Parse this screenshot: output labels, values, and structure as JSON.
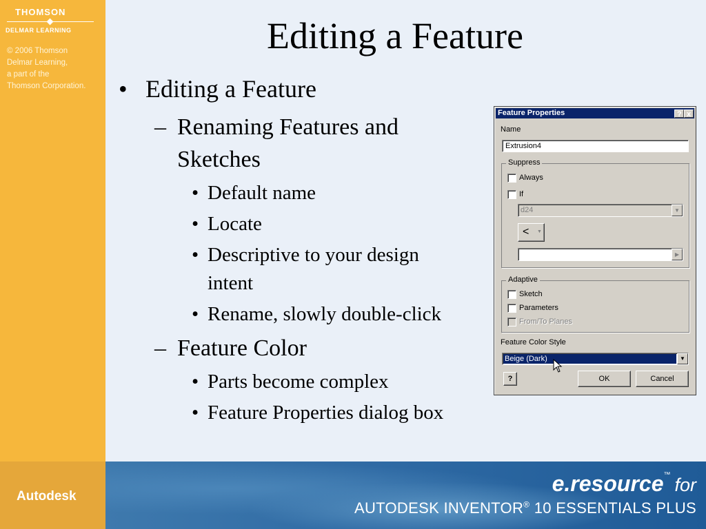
{
  "sidebar": {
    "brand_top": "THOMSON",
    "brand_bottom": "DELMAR LEARNING",
    "copyright": [
      "© 2006 Thomson",
      "Delmar Learning,",
      "a part of the",
      "Thomson Corporation."
    ]
  },
  "footer": {
    "left_label": "Autodesk",
    "eresource": "e.resource",
    "tm": "™",
    "for": "for",
    "product": "AUTODESK INVENTOR",
    "reg": "®",
    "product_rest": " 10 ESSENTIALS PLUS"
  },
  "slide": {
    "title": "Editing a Feature",
    "bullets": [
      {
        "level": 1,
        "marker": "•",
        "text": "Editing a Feature"
      },
      {
        "level": 2,
        "marker": "–",
        "text": "Renaming Features and"
      },
      {
        "level": 2,
        "marker": "",
        "text": "Sketches"
      },
      {
        "level": 3,
        "marker": "•",
        "text": "Default name"
      },
      {
        "level": 3,
        "marker": "•",
        "text": "Locate"
      },
      {
        "level": 3,
        "marker": "•",
        "text": "Descriptive to your design"
      },
      {
        "level": 3,
        "marker": "",
        "text": "intent"
      },
      {
        "level": 3,
        "marker": "•",
        "text": "Rename, slowly double-click"
      },
      {
        "level": 2,
        "marker": "–",
        "text": "Feature Color"
      },
      {
        "level": 3,
        "marker": "•",
        "text": "Parts become complex"
      },
      {
        "level": 3,
        "marker": "•",
        "text": "Feature Properties dialog box"
      }
    ]
  },
  "dialog": {
    "title": "Feature Properties",
    "help_btn": "?",
    "close_btn": "x",
    "name_label": "Name",
    "name_value": "Extrusion4",
    "suppress_label": "Suppress",
    "always_label": "Always",
    "if_label": "If",
    "param_value": "d24",
    "operator_value": "<",
    "adaptive_label": "Adaptive",
    "sketch_label": "Sketch",
    "parameters_label": "Parameters",
    "fromto_label": "From/To Planes",
    "color_style_label": "Feature Color Style",
    "color_style_value": "Beige (Dark)",
    "ok_label": "OK",
    "cancel_label": "Cancel",
    "selection_color": "#0a246a"
  }
}
